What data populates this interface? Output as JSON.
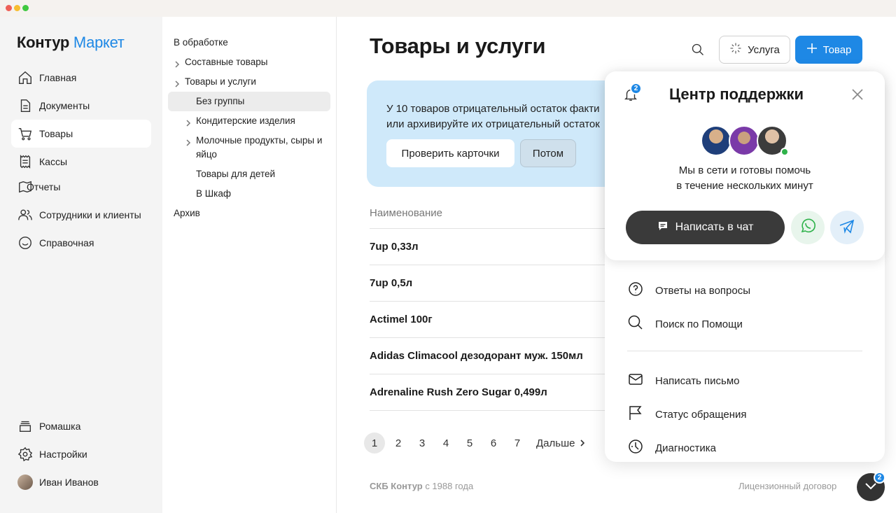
{
  "brand": {
    "name_bold": "Контур",
    "name_light": "Маркет",
    "accent": "#1e88e5"
  },
  "nav": {
    "items": [
      {
        "label": "Главная",
        "icon": "home-icon"
      },
      {
        "label": "Документы",
        "icon": "document-icon"
      },
      {
        "label": "Товары",
        "icon": "cart-icon",
        "active": true
      },
      {
        "label": "Кассы",
        "icon": "receipt-icon"
      },
      {
        "label": "Отчеты",
        "icon": "report-icon"
      },
      {
        "label": "Сотрудники и клиенты",
        "icon": "users-icon"
      },
      {
        "label": "Справочная",
        "icon": "smile-icon"
      }
    ],
    "bottom": [
      {
        "label": "Ромашка",
        "icon": "store-icon"
      },
      {
        "label": "Настройки",
        "icon": "gear-icon"
      },
      {
        "label": "Иван Иванов",
        "icon": "user-avatar"
      }
    ]
  },
  "tree": {
    "items": [
      {
        "label": "В обработке"
      },
      {
        "label": "Составные товары"
      },
      {
        "label": "Товары и услуги"
      },
      {
        "label": "Без группы",
        "selected": true
      },
      {
        "label": "Кондитерские изделия"
      },
      {
        "label": "Молочные продукты, сыры и яйцо"
      },
      {
        "label": "Товары для детей"
      },
      {
        "label": "В Шкаф"
      },
      {
        "label": "Архив"
      }
    ]
  },
  "main": {
    "title": "Товары и услуги",
    "service_button": "Услуга",
    "product_button": "Товар",
    "banner": {
      "line1": "У 10 товаров отрицательный остаток факти",
      "line2": "или архивируйте их отрицательный остаток",
      "check_button": "Проверить карточки",
      "later_button": "Потом"
    },
    "table": {
      "column_name": "Наименование",
      "rows": [
        "7up 0,33л",
        "7up 0,5л",
        "Actimel 100г",
        "Adidas Climacool дезодорант муж. 150мл",
        "Adrenaline Rush Zero Sugar 0,499л"
      ]
    },
    "pager": {
      "pages": [
        "1",
        "2",
        "3",
        "4",
        "5",
        "6",
        "7"
      ],
      "current": "1",
      "next": "Дальше"
    },
    "footer": {
      "company": "СКБ Контур",
      "since": " с 1988 года",
      "license": "Лицензионный договор"
    }
  },
  "support": {
    "title": "Центр поддержки",
    "notifications": "2",
    "subtitle_line1": "Мы в сети и готовы помочь",
    "subtitle_line2": "в течение нескольких минут",
    "chat_button": "Написать в чат",
    "menu": [
      {
        "label": "Ответы на вопросы",
        "icon": "question-icon"
      },
      {
        "label": "Поиск по Помощи",
        "icon": "search-icon"
      },
      {
        "label": "Написать письмо",
        "icon": "mail-icon"
      },
      {
        "label": "Статус обращения",
        "icon": "flag-icon"
      },
      {
        "label": "Диагностика",
        "icon": "diagnostics-icon"
      }
    ],
    "fab_badge": "2"
  }
}
